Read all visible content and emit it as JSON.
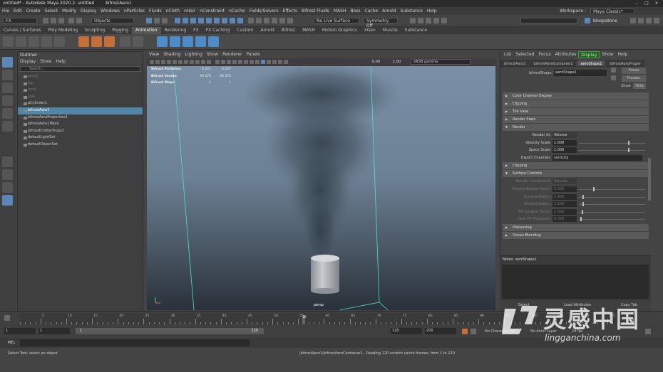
{
  "titlebar": {
    "title": "untitled* - Autodesk Maya 2020.2: untitled",
    "node": "bifrostAero1"
  },
  "menubar": {
    "items": [
      "File",
      "Edit",
      "Create",
      "Select",
      "Modify",
      "Display",
      "Windows",
      "nParticles",
      "Fluids",
      "nCloth",
      "nHair",
      "nConstraint",
      "nCache",
      "Fields/Solvers",
      "Effects",
      "Bifrost Fluids",
      "MASH",
      "Boss",
      "Cache",
      "Arnold",
      "Substance",
      "Help"
    ],
    "workspace_label": "Workspace :",
    "workspace_value": "Maya Classic*"
  },
  "statusline": {
    "mode": "FX",
    "select_mode": "Objects",
    "live_surface": "No Live Surface",
    "symmetry": "Symmetry: Off",
    "user": "bloopatone"
  },
  "shelf": {
    "tabs": [
      "Curves / Surfaces",
      "Poly Modeling",
      "Sculpting",
      "Rigging",
      "Animation",
      "Rendering",
      "FX",
      "FX Caching",
      "Custom",
      "Arnold",
      "Bifrost",
      "MASH",
      "Motion Graphics",
      "XGen",
      "Muscle",
      "Substance"
    ],
    "active_tab": "Animation"
  },
  "outliner": {
    "title": "Outliner",
    "menu": [
      "Display",
      "Show",
      "Help"
    ],
    "search_placeholder": "Search...",
    "items": [
      {
        "label": "persp",
        "state": "dim"
      },
      {
        "label": "top",
        "state": "dim"
      },
      {
        "label": "front",
        "state": "dim"
      },
      {
        "label": "side",
        "state": "dim"
      },
      {
        "label": "pCylinder1",
        "state": ""
      },
      {
        "label": "bifrostAero1",
        "state": "sel"
      },
      {
        "label": "bifrostAeroProperties1",
        "state": ""
      },
      {
        "label": "bifrostAero1Mesh",
        "state": ""
      },
      {
        "label": "bifrostEmitterProps1",
        "state": ""
      },
      {
        "label": "defaultLightSet",
        "state": ""
      },
      {
        "label": "defaultObjectSet",
        "state": ""
      }
    ]
  },
  "viewport": {
    "menu": [
      "View",
      "Shading",
      "Lighting",
      "Show",
      "Renderer",
      "Panels"
    ],
    "gamma": "sRGB gamma",
    "exposure": "0.00",
    "gamma_value": "1.00",
    "hud": [
      {
        "label": "Bifrost Particles:",
        "v1": "6 227",
        "v2": "6 227"
      },
      {
        "label": "Bifrost Voxels:",
        "v1": "93 375",
        "v2": "93 375"
      },
      {
        "label": "Bifrost Maps:",
        "v1": "1",
        "v2": "1"
      }
    ],
    "camera": "persp"
  },
  "attr_editor": {
    "menu": [
      "List",
      "Selected",
      "Focus",
      "Attributes",
      "Display",
      "Show",
      "Help"
    ],
    "highlight": "Display",
    "tabs": [
      "bifrostAero1",
      "bifrostAeroContainer1",
      "aeroShape1",
      "bifrostAeroProper"
    ],
    "active_tab": "aeroShape1",
    "shape_label": "bifrostShape:",
    "shape_value": "aeroShape1",
    "focus_button": "Focus",
    "presets_button": "Presets",
    "show_button": "Show",
    "hide_button": "Hide",
    "sections_top": [
      "Color Channel Display",
      "Clipping",
      "Tile View",
      "Render Stats",
      "Render"
    ],
    "render_rows": [
      {
        "label": "Render As",
        "value": "Volume",
        "kind": "dropdown"
      },
      {
        "label": "Velocity Scale",
        "value": "1.000",
        "kind": "slider",
        "knob": 0.88
      },
      {
        "label": "Space Scale",
        "value": "1.000",
        "kind": "slider",
        "knob": 0.88
      },
      {
        "label": "Export Channels",
        "value": "vorticity",
        "kind": "text"
      }
    ],
    "sections_mid": [
      "Clipping",
      "Surface Controls"
    ],
    "surface_rows": [
      {
        "label": "Render Component",
        "value": "Volume",
        "kind": "dropdown"
      },
      {
        "label": "Droplet Reveal Factor",
        "value": "5.000",
        "kind": "slider",
        "knob": 0.25
      },
      {
        "label": "Surface Radius",
        "value": "1.400",
        "kind": "slider",
        "knob": 0.07
      },
      {
        "label": "Droplet Radius",
        "value": "1.200",
        "kind": "slider",
        "knob": 0.06
      },
      {
        "label": "Kill Surface Factor",
        "value": "1.000",
        "kind": "slider",
        "knob": 0.05
      },
      {
        "label": "Hole Fill Threshold",
        "value": "0.050",
        "kind": "slider",
        "knob": 0.02
      }
    ],
    "sections_bottom": [
      "Processing",
      "Ocean Blending"
    ],
    "notes_label": "Notes:",
    "notes_node": "aeroShape1",
    "select_button": "Select",
    "load_attrs_button": "Load Attributes",
    "copy_tab_button": "Copy Tab"
  },
  "timeslider": {
    "labels": [
      "5",
      "10",
      "15",
      "20",
      "25",
      "30",
      "35",
      "40",
      "45",
      "50",
      "55",
      "60",
      "65",
      "70",
      "75",
      "80",
      "85",
      "90",
      "95",
      "100",
      "105",
      "110",
      "115"
    ],
    "current_frame": "56"
  },
  "rangebar": {
    "start": "1",
    "range_start": "1",
    "range_field": "1",
    "range_end_label": "120",
    "range_end": "120",
    "end": "200",
    "character_set": "No Character Set",
    "anim_layer": "No Anim Layer",
    "fps": "24 fps"
  },
  "mel": {
    "label": "MEL"
  },
  "help": {
    "text": "Select Tool: select an object",
    "message": "|bifrostAero1|bifrostAeroContainer1 - Reading 120 scratch cache frames, from 1 to 120"
  },
  "watermark": {
    "cn": "灵感中国",
    "url": "lingganchina.com"
  }
}
